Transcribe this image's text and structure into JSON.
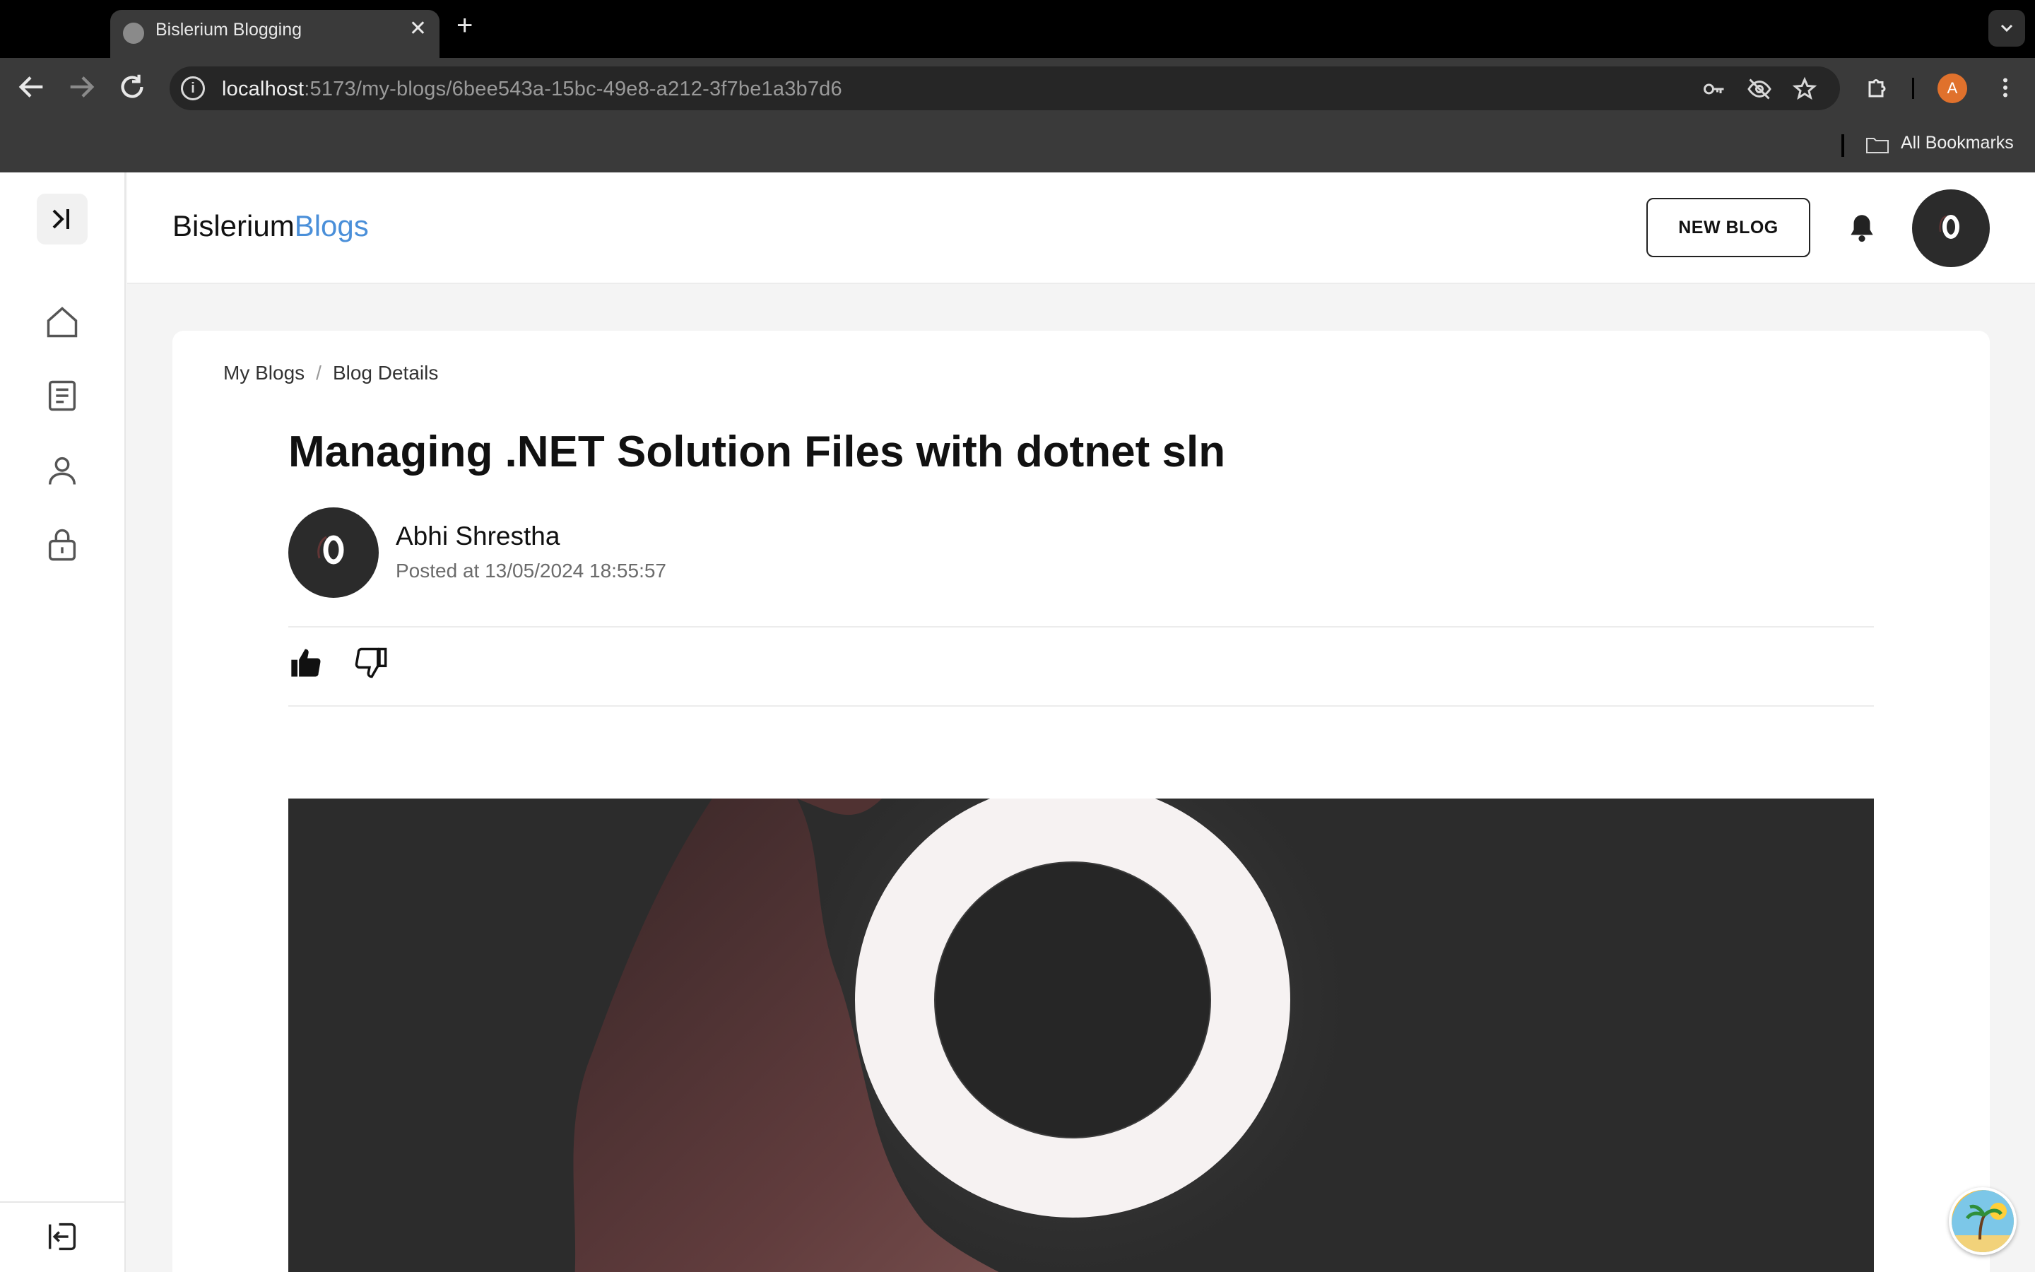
{
  "browser": {
    "tab_title": "Bislerium Blogging",
    "url_host": "localhost",
    "url_path": ":5173/my-blogs/6bee543a-15bc-49e8-a212-3f7be1a3b7d6",
    "profile_initial": "A",
    "bookmarks_label": "All Bookmarks"
  },
  "header": {
    "brand_part1": "Bislerium",
    "brand_part2": "Blogs",
    "new_blog_label": "NEW BLOG",
    "accent_color": "#4a8fd9"
  },
  "sidebar": {
    "items": [
      {
        "icon": "home-icon"
      },
      {
        "icon": "document-icon"
      },
      {
        "icon": "user-icon"
      },
      {
        "icon": "lock-icon"
      }
    ],
    "logout_icon": "logout-icon"
  },
  "breadcrumb": {
    "items": [
      "My Blogs",
      "Blog Details"
    ],
    "separator": "/"
  },
  "post": {
    "title": "Managing .NET Solution Files with dotnet sln",
    "author": "Abhi Shrestha",
    "posted_at": "Posted at 13/05/2024 18:55:57"
  }
}
